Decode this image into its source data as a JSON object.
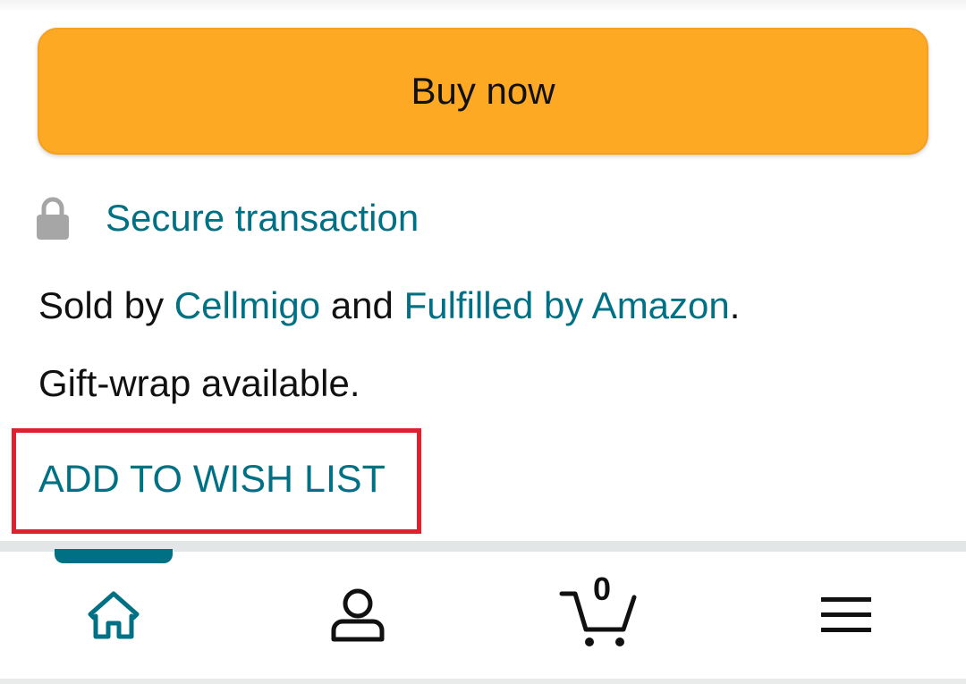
{
  "buy_box": {
    "buy_now_label": "Buy now",
    "buy_now_color": "#fda924",
    "secure_transaction_label": "Secure transaction",
    "sold_by_prefix": "Sold by ",
    "seller_name": "Cellmigo",
    "and_text": " and ",
    "fulfilled_by": "Fulfilled by Amazon",
    "period": ".",
    "gift_wrap_text": "Gift-wrap available.",
    "add_to_wish_list_label": "ADD TO WISH LIST"
  },
  "colors": {
    "link": "#007185",
    "highlight_box": "#e0202e"
  },
  "bottom_nav": {
    "active_tab": "home",
    "items": [
      {
        "name": "home",
        "icon": "home-icon"
      },
      {
        "name": "account",
        "icon": "user-icon"
      },
      {
        "name": "cart",
        "icon": "cart-icon",
        "count": "0"
      },
      {
        "name": "menu",
        "icon": "hamburger-menu-icon"
      }
    ]
  }
}
